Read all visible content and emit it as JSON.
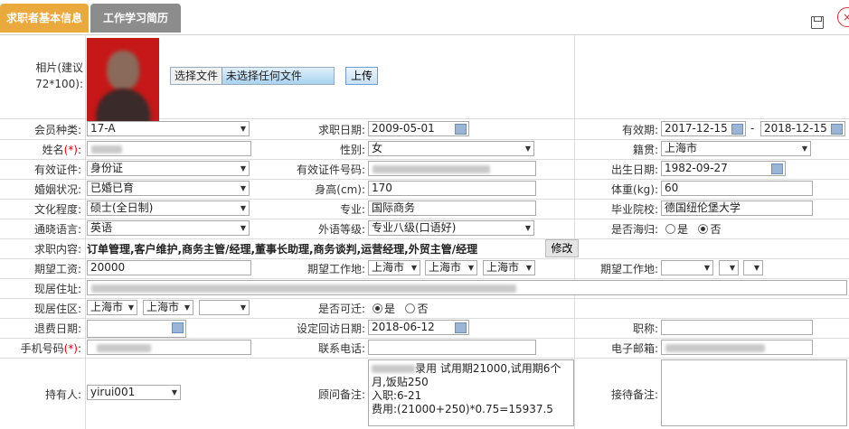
{
  "tabs": [
    "求职者基本信息",
    "工作学习简历"
  ],
  "photo": {
    "label": "相片(建议72*100):",
    "choose": "选择文件",
    "none": "未选择任何文件",
    "upload": "上传"
  },
  "f": {
    "member_type_label": "会员种类:",
    "member_type": "17-A",
    "apply_date_label": "求职日期:",
    "apply_date": "2009-05-01",
    "valid_label": "有效期:",
    "valid_from": "2017-12-15",
    "valid_dash": "-",
    "valid_to": "2018-12-15",
    "name_label": "姓名",
    "star": "(*)",
    "colon": ":",
    "gender_label": "性别:",
    "gender": "女",
    "native_label": "籍贯:",
    "native": "上海市",
    "id_type_label": "有效证件:",
    "id_type": "身份证",
    "id_no_label": "有效证件号码:",
    "birth_label": "出生日期:",
    "birth": "1982-09-27",
    "marital_label": "婚姻状况:",
    "marital": "已婚已育",
    "height_label": "身高(cm):",
    "height": "170",
    "weight_label": "体重(kg):",
    "weight": "60",
    "edu_label": "文化程度:",
    "edu": "硕士(全日制)",
    "major_label": "专业:",
    "major": "国际商务",
    "school_label": "毕业院校:",
    "school": "德国纽伦堡大学",
    "lang_label": "通晓语言:",
    "lang": "英语",
    "lang_level_label": "外语等级:",
    "lang_level": "专业八级(口语好)",
    "overseas_label": "是否海归:",
    "yes": "是",
    "no": "否",
    "content_label": "求职内容:",
    "content": "订单管理,客户维护,商务主管/经理,董事长助理,商务谈判,运营经理,外贸主管/经理",
    "modify": "修改",
    "salary_label": "期望工资:",
    "salary": "20000",
    "work_loc_label": "期望工作地:",
    "work_loc1": "上海市",
    "work_loc2": "上海市",
    "work_loc3": "上海市",
    "work_loc2_label": "期望工作地:",
    "addr_label": "现居住址:",
    "area_label": "现居住区:",
    "area1": "上海市",
    "area2": "上海市",
    "relocate_label": "是否可迁:",
    "refund_label": "退费日期:",
    "revisit_label": "设定回访日期:",
    "revisit": "2018-06-12",
    "title_label": "职称:",
    "mobile_label": "手机号码",
    "phone_label": "联系电话:",
    "email_label": "电子邮箱:",
    "holder_label": "持有人:",
    "holder": "yirui001",
    "consult_label": "顾问备注:",
    "consult_l1": "录用 试用期21000,试用期6个",
    "consult_l2": "月,饭贴250",
    "consult_l3": "入职:6-21",
    "consult_l4": "费用:(21000+250)*0.75=15937.5",
    "reception_label": "接待备注:"
  }
}
